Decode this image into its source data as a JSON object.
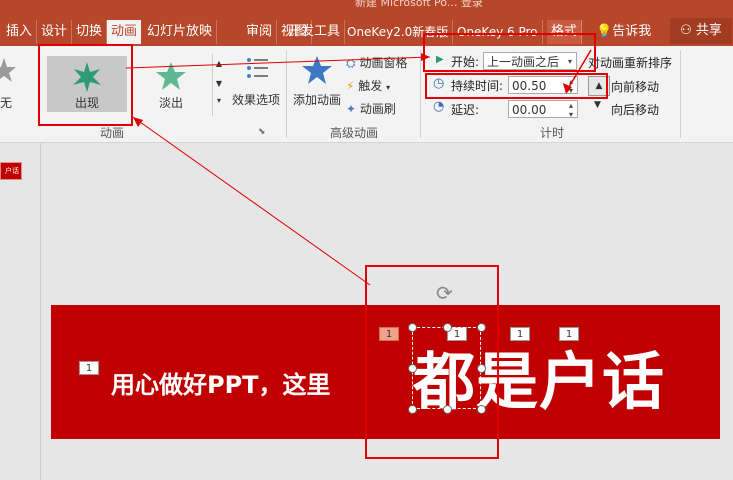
{
  "window": {
    "title_fragment": "新建 Microsoft Po...   登录"
  },
  "tabs": [
    {
      "label": "插入"
    },
    {
      "label": "设计"
    },
    {
      "label": "切换"
    },
    {
      "label": "动画"
    },
    {
      "label": "幻灯片放映"
    },
    {
      "label": "审阅"
    },
    {
      "label": "视图"
    },
    {
      "label": "开发工具"
    },
    {
      "label": "OneKey2.0新春版"
    },
    {
      "label": "OneKey 6 Pro"
    },
    {
      "label": "格式"
    }
  ],
  "tell_me": "告诉我",
  "share": "共享",
  "ribbon": {
    "animation_gallery": {
      "none_label": "无",
      "appear_label": "出现",
      "fade_label": "淡出",
      "group_label": "动画"
    },
    "effect_options": "效果选项",
    "advanced": {
      "add_animation": "添加动画",
      "animation_pane": "动画窗格",
      "trigger": "触发",
      "animation_painter": "动画刷",
      "group_label": "高级动画"
    },
    "timing": {
      "start_label": "开始:",
      "start_value": "上一动画之后",
      "duration_label": "持续时间:",
      "duration_value": "00.50",
      "delay_label": "延迟:",
      "delay_value": "00.00",
      "reorder_label": "对动画重新排序",
      "move_earlier": "向前移动",
      "move_later": "向后移动",
      "group_label": "计时"
    }
  },
  "thumbnail": {
    "label": "户话"
  },
  "slide": {
    "text_small": "用心做好PPT，这里",
    "text_large": "都是户话",
    "badges": [
      "1",
      "1",
      "1",
      "1",
      "1"
    ]
  },
  "colors": {
    "accent": "#b7472a",
    "slide_red": "#c00000",
    "annotation_red": "#e00000"
  }
}
